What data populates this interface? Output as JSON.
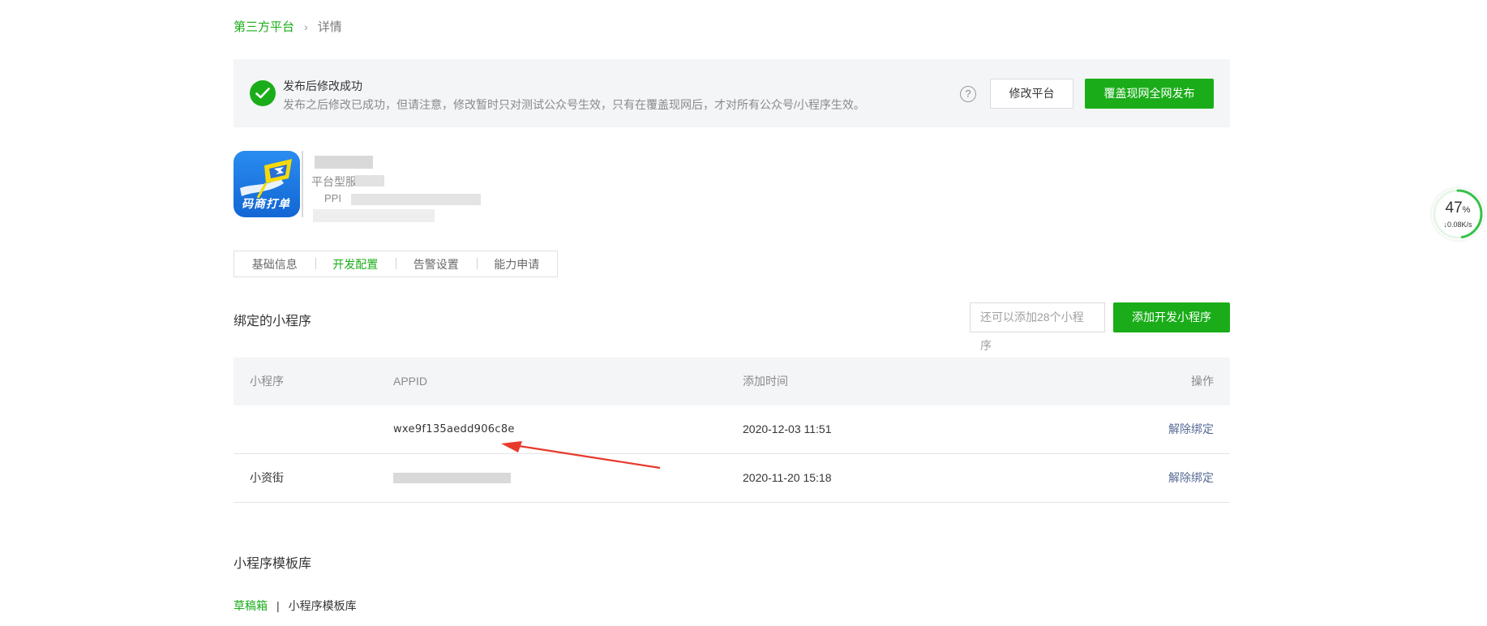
{
  "breadcrumb": {
    "parent": "第三方平台",
    "separator": "›",
    "current": "详情"
  },
  "notice": {
    "title": "发布后修改成功",
    "description": "发布之后修改已成功，但请注意，修改暂时只对测试公众号生效，只有在覆盖现网后，才对所有公众号/小程序生效。",
    "help_symbol": "?",
    "modify_label": "修改平台",
    "publish_label": "覆盖现网全网发布"
  },
  "app": {
    "logo_text": "码商打单",
    "type_label": "平台型服务",
    "id_label": "PPI"
  },
  "tabs": [
    {
      "label": "基础信息",
      "active": false
    },
    {
      "label": "开发配置",
      "active": true
    },
    {
      "label": "告警设置",
      "active": false
    },
    {
      "label": "能力申请",
      "active": false
    }
  ],
  "bound": {
    "title": "绑定的小程序",
    "quota_text": "还可以添加28个小程序",
    "add_label": "添加开发小程序",
    "columns": [
      "小程序",
      "APPID",
      "添加时间",
      "操作"
    ],
    "rows": [
      {
        "name": "",
        "appid": "wxe9f135aedd906c8e",
        "time": "2020-12-03 11:51",
        "action": "解除绑定"
      },
      {
        "name": "小资街",
        "appid": "",
        "time": "2020-11-20 15:18",
        "action": "解除绑定"
      }
    ]
  },
  "templates": {
    "title": "小程序模板库",
    "tabs": [
      "草稿箱",
      "小程序模板库"
    ],
    "separator": "|"
  },
  "speed_widget": {
    "percent": "47",
    "percent_unit": "%",
    "rate": "↓0.08K/s",
    "level": 0.47
  },
  "colors": {
    "brand": "#1aad19",
    "link": "#576b95",
    "annotation_arrow": "#e8392b"
  }
}
